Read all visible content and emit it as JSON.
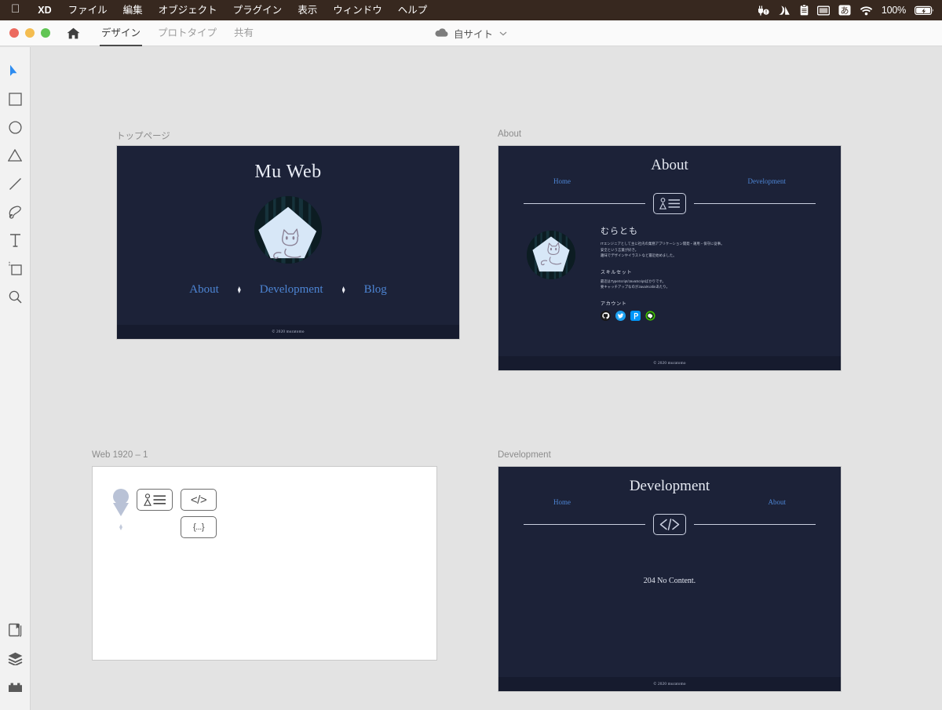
{
  "menubar": {
    "apple_icon": "apple-logo-icon",
    "app_name": "XD",
    "items": [
      "ファイル",
      "編集",
      "オブジェクト",
      "プラグイン",
      "表示",
      "ウィンドウ",
      "ヘルプ"
    ],
    "status_icons": [
      "plug-alert-icon",
      "signal-icon",
      "clipboard-icon",
      "display-icon",
      "ime-kana-icon",
      "wifi-icon"
    ],
    "ime_label": "あ",
    "battery_percent": "100%",
    "battery_icon": "battery-charging-icon",
    "bg_color": "#37281f"
  },
  "titlebar": {
    "traffic_lights": [
      "close",
      "minimize",
      "zoom"
    ],
    "home_icon": "home-icon",
    "tabs": [
      {
        "label": "デザイン",
        "active": true
      },
      {
        "label": "プロトタイプ",
        "active": false
      },
      {
        "label": "共有",
        "active": false
      }
    ],
    "cloud_icon": "cloud-icon",
    "document_name": "自サイト",
    "chevron": "⌄"
  },
  "toolbar": {
    "tools": [
      {
        "name": "select-tool",
        "icon": "cursor-arrow-icon",
        "active": true
      },
      {
        "name": "rectangle-tool",
        "icon": "square-icon",
        "active": false
      },
      {
        "name": "ellipse-tool",
        "icon": "circle-icon",
        "active": false
      },
      {
        "name": "polygon-tool",
        "icon": "triangle-icon",
        "active": false
      },
      {
        "name": "line-tool",
        "icon": "line-icon",
        "active": false
      },
      {
        "name": "pen-tool",
        "icon": "pen-icon",
        "active": false
      },
      {
        "name": "text-tool",
        "icon": "text-t-icon",
        "active": false
      },
      {
        "name": "artboard-tool",
        "icon": "artboard-icon",
        "active": false
      },
      {
        "name": "zoom-tool",
        "icon": "magnifier-icon",
        "active": false
      }
    ],
    "bottom_tools": [
      {
        "name": "assets-panel",
        "icon": "assets-icon"
      },
      {
        "name": "layers-panel",
        "icon": "layers-icon"
      },
      {
        "name": "plugins-panel",
        "icon": "plugins-icon"
      }
    ],
    "active_color": "#2d8cf0"
  },
  "canvas": {
    "background": "#e3e3e3",
    "artboards": [
      {
        "id": "top",
        "label": "トップページ",
        "background": "#1c2238",
        "title": "Mu Web",
        "avatar_icon": "cat-avatar-icon",
        "nav": [
          "About",
          "Development",
          "Blog"
        ],
        "separator_icon": "diamond-separator-icon",
        "footer": "© 2020 muratomo"
      },
      {
        "id": "about",
        "label": "About",
        "background": "#1c2238",
        "title": "About",
        "nav_left": "Home",
        "nav_right": "Development",
        "badge_icon": "id-card-icon",
        "avatar_icon": "cat-avatar-icon",
        "name": "むらとも",
        "bio": [
          "ITエンジニアとして主に社内の業務アプリケーション開発・運用・保守に従事。",
          "安全という言葉が好き。",
          "趣味でデザインやイラストなど最近始めました。"
        ],
        "skills_heading": "スキルセット",
        "skills": [
          "最近はTypeScript/JavaScriptばかりです。",
          "要キャッチアップなのがJava/Kotlinあたり。"
        ],
        "accounts_heading": "アカウント",
        "accounts": [
          {
            "name": "github-icon",
            "color": "#181717"
          },
          {
            "name": "twitter-icon",
            "color": "#1da1f2"
          },
          {
            "name": "pixiv-icon",
            "color": "#0096fa"
          },
          {
            "name": "line-icon",
            "color": "#41c300"
          }
        ],
        "footer": "© 2020 muratomo"
      },
      {
        "id": "web1920",
        "label": "Web 1920 – 1",
        "background": "#ffffff",
        "shapes": [
          {
            "name": "pin-shape",
            "color": "#b9c2d6"
          },
          {
            "name": "diamond-shape",
            "color": "#c3cbdb"
          },
          {
            "name": "id-card-icon",
            "label": ""
          },
          {
            "name": "code-icon",
            "label": "</>"
          },
          {
            "name": "object-icon",
            "label": "{...}"
          }
        ]
      },
      {
        "id": "development",
        "label": "Development",
        "background": "#1c2238",
        "title": "Development",
        "nav_left": "Home",
        "nav_right": "About",
        "badge_icon": "code-icon",
        "badge_label": "</>",
        "message": "204 No Content.",
        "footer": "© 2020 muratomo"
      }
    ]
  }
}
